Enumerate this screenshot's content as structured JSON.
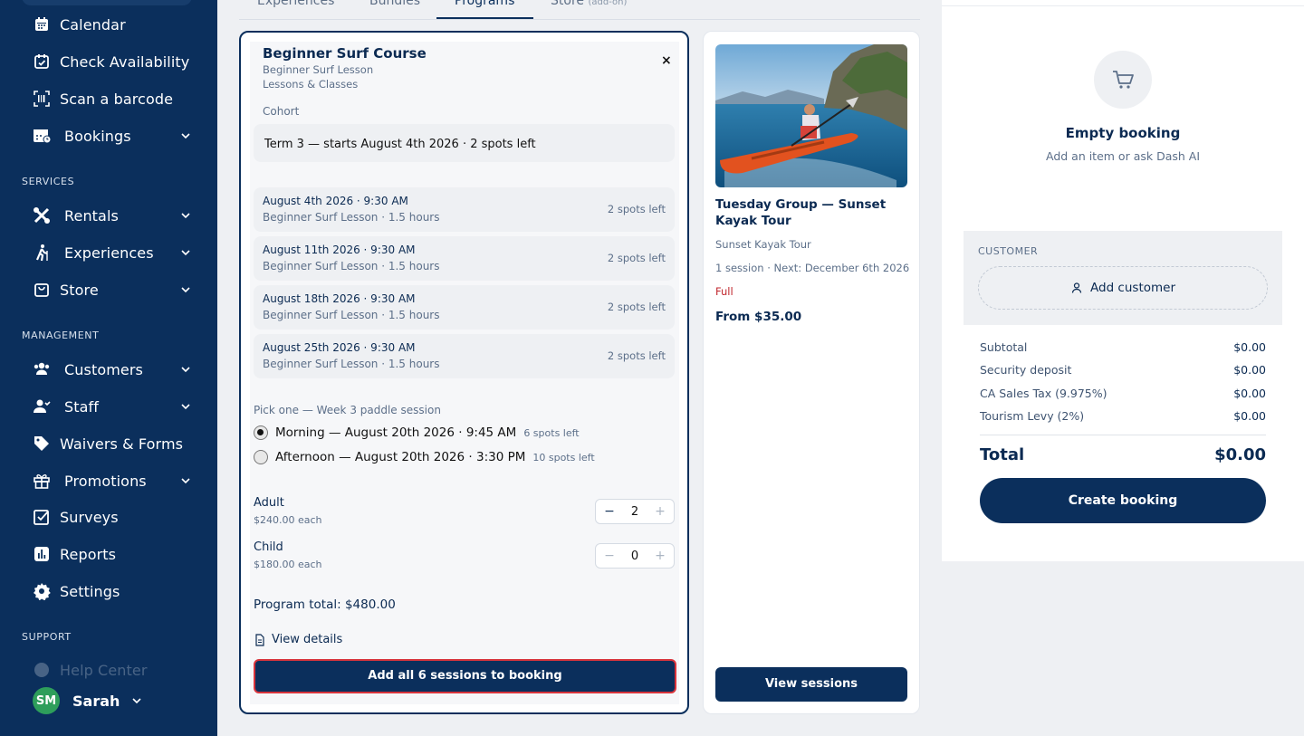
{
  "sidebar": {
    "items": [
      {
        "label": "Calendar",
        "icon": "calendar-icon"
      },
      {
        "label": "Check Availability",
        "icon": "calendar-check-icon"
      },
      {
        "label": "Scan a barcode",
        "icon": "barcode-icon"
      },
      {
        "label": "Bookings",
        "icon": "bookings-icon"
      },
      {
        "label": "Rentals",
        "icon": "rentals-icon"
      },
      {
        "label": "Experiences",
        "icon": "hiking-icon"
      },
      {
        "label": "Store",
        "icon": "store-icon"
      },
      {
        "label": "Customers",
        "icon": "customers-icon"
      },
      {
        "label": "Staff",
        "icon": "staff-icon"
      },
      {
        "label": "Waivers & Forms",
        "icon": "tag-icon"
      },
      {
        "label": "Promotions",
        "icon": "gift-icon"
      },
      {
        "label": "Surveys",
        "icon": "survey-icon"
      },
      {
        "label": "Reports",
        "icon": "reports-icon"
      },
      {
        "label": "Settings",
        "icon": "gear-icon"
      },
      {
        "label": "Help Center",
        "icon": "help-icon"
      }
    ],
    "sections": {
      "services": "SERVICES",
      "management": "MANAGEMENT",
      "support": "SUPPORT"
    },
    "user": {
      "initials": "SM",
      "name": "Sarah"
    }
  },
  "tabs": [
    {
      "label": "Experiences"
    },
    {
      "label": "Bundles"
    },
    {
      "label": "Programs"
    },
    {
      "label": "Store",
      "tag": "(add-on)"
    }
  ],
  "program": {
    "title": "Beginner Surf Course",
    "subtitle": "Beginner Surf Lesson",
    "category": "Lessons & Classes",
    "cohort_label": "Cohort",
    "cohort_value": "Term 3 — starts August 4th 2026 · 2 spots left",
    "sessions": [
      {
        "date": "August 4th 2026 · 9:30 AM",
        "detail": "Beginner Surf Lesson · 1.5 hours",
        "spots": "2 spots left"
      },
      {
        "date": "August 11th 2026 · 9:30 AM",
        "detail": "Beginner Surf Lesson · 1.5 hours",
        "spots": "2 spots left"
      },
      {
        "date": "August 18th 2026 · 9:30 AM",
        "detail": "Beginner Surf Lesson · 1.5 hours",
        "spots": "2 spots left"
      },
      {
        "date": "August 25th 2026 · 9:30 AM",
        "detail": "Beginner Surf Lesson · 1.5 hours",
        "spots": "2 spots left"
      }
    ],
    "pick_label": "Pick one — Week 3 paddle session",
    "options": [
      {
        "label": "Morning — August 20th 2026 · 9:45 AM",
        "spots": "6 spots left",
        "selected": true
      },
      {
        "label": "Afternoon — August 20th 2026 · 3:30 PM",
        "spots": "10 spots left",
        "selected": false
      }
    ],
    "tickets": [
      {
        "name": "Adult",
        "price": "$240.00 each",
        "qty": "2"
      },
      {
        "name": "Child",
        "price": "$180.00 each",
        "qty": "0"
      }
    ],
    "total": "Program total: $480.00",
    "details_label": "View details",
    "add_button": "Add all 6 sessions to booking"
  },
  "tour": {
    "title": "Tuesday Group — Sunset Kayak Tour",
    "subtitle": "Sunset Kayak Tour",
    "next": "1 session · Next: December 6th 2026",
    "status": "Full",
    "price": "From $35.00",
    "button": "View sessions"
  },
  "booking": {
    "empty_title": "Empty booking",
    "empty_sub": "Add an item or ask Dash AI",
    "customer_label": "CUSTOMER",
    "add_customer": "Add customer",
    "lines": [
      {
        "label": "Subtotal",
        "amount": "$0.00"
      },
      {
        "label": "Security deposit",
        "amount": "$0.00"
      },
      {
        "label": "CA Sales Tax (9.975%)",
        "amount": "$0.00"
      },
      {
        "label": "Tourism Levy (2%)",
        "amount": "$0.00"
      }
    ],
    "total_label": "Total",
    "total_amount": "$0.00",
    "create_button": "Create booking"
  },
  "colors": {
    "navy": "#0b2f5c",
    "accent_red": "#c0262d",
    "success": "#2e9e5b"
  }
}
